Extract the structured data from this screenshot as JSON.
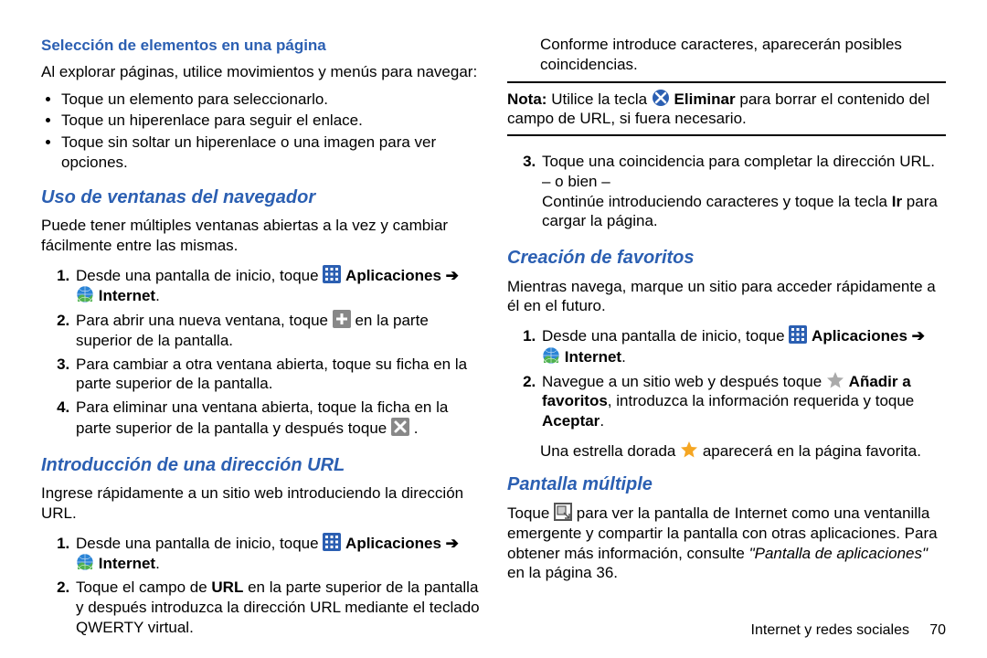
{
  "left": {
    "h3a": "Selección de elementos en una página",
    "p1": "Al explorar páginas, utilice movimientos y menús para navegar:",
    "bul1": "Toque un elemento para seleccionarlo.",
    "bul2": "Toque un hiperenlace para seguir el enlace.",
    "bul3": "Toque sin soltar un hiperenlace o una imagen para ver opciones.",
    "h2a": "Uso de ventanas del navegador",
    "p2": "Puede tener múltiples ventanas abiertas a la vez y cambiar fácilmente entre las mismas.",
    "s1a": "Desde una pantalla de inicio, toque ",
    "s1_apps": " Aplicaciones ➔",
    "s1_internet": " Internet",
    "s2a": "Para abrir una nueva ventana, toque ",
    "s2b": " en la parte superior de la pantalla.",
    "s3": "Para cambiar a otra ventana abierta, toque su ficha en la parte superior de la pantalla.",
    "s4a": "Para eliminar una ventana abierta, toque la ficha en la parte superior de la pantalla y después toque ",
    "h2b": "Introducción de una dirección URL",
    "p3": "Ingrese rápidamente a un sitio web introduciendo la dirección URL.",
    "u1a": "Desde una pantalla de inicio, toque ",
    "u1_apps": " Aplicaciones ➔",
    "u1_internet": " Internet",
    "u2a": "Toque el campo de ",
    "u2_url": "URL",
    "u2b": " en la parte superior de la pantalla y después introduzca la dirección URL mediante el teclado QWERTY virtual."
  },
  "right": {
    "p0": "Conforme introduce caracteres, aparecerán posibles coincidencias.",
    "note_lbl": "Nota:",
    "note_a": " Utilice la tecla ",
    "note_elim": " Eliminar",
    "note_b": " para borrar el contenido del campo de URL, si fuera necesario.",
    "s3a": "Toque una coincidencia para completar la dirección URL.",
    "s3b": "– o bien –",
    "s3c": "Continúe introduciendo caracteres y toque la tecla ",
    "s3_ir": "Ir",
    "s3d": " para cargar la página.",
    "h2a": "Creación de favoritos",
    "p1": "Mientras navega, marque un sitio para acceder rápidamente a él en el futuro.",
    "f1a": "Desde una pantalla de inicio, toque ",
    "f1_apps": " Aplicaciones ➔",
    "f1_internet": " Internet",
    "f2a": "Navegue a un sitio web y después toque ",
    "f2_add": " Añadir a favoritos",
    "f2b": ", introduzca la información requerida y toque ",
    "f2_aceptar": "Aceptar",
    "f3a": "Una estrella dorada ",
    "f3b": " aparecerá en la página favorita.",
    "h2b": "Pantalla múltiple",
    "pm_a": "Toque ",
    "pm_b": " para ver la pantalla de Internet como una ventanilla emergente y compartir la pantalla con otras aplicaciones. Para obtener más información, consulte ",
    "pm_ref": "\"Pantalla de aplicaciones\"",
    "pm_c": " en la página 36.",
    "footer_section": "Internet y redes sociales",
    "footer_page": "70"
  }
}
